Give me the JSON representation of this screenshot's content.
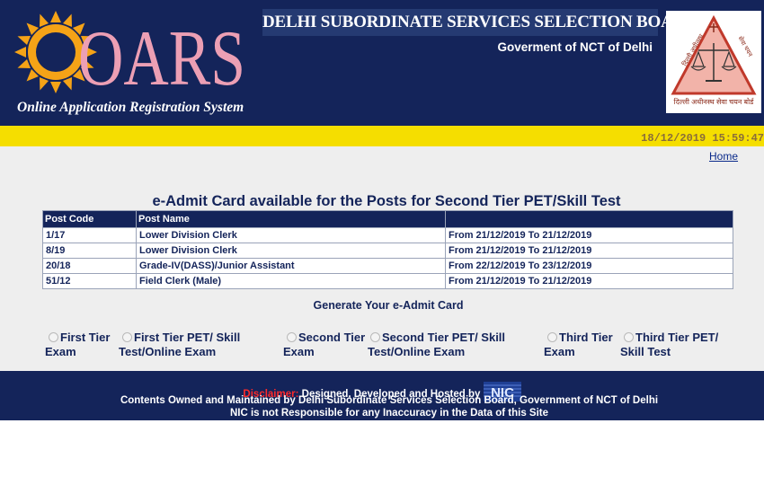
{
  "header": {
    "logo_text": "OARS",
    "tagline": "Online Application Registration System",
    "board_title": "DELHI SUBORDINATE SERVICES SELECTION BOARD",
    "govt": "Goverment of NCT of Delhi",
    "emblem_text": "दिल्ली अधीनस्थ सेवा चयन बोर्ड"
  },
  "datetime": "18/12/2019 15:59:47",
  "nav": {
    "home": "Home"
  },
  "admit": {
    "title": "e-Admit Card available for the Posts for Second Tier PET/Skill Test",
    "columns": [
      "Post Code",
      "Post Name",
      ""
    ],
    "rows": [
      [
        "1/17",
        "Lower Division Clerk",
        "From 21/12/2019 To 21/12/2019"
      ],
      [
        "8/19",
        "Lower Division Clerk",
        "From 21/12/2019 To 21/12/2019"
      ],
      [
        "20/18",
        "Grade-IV(DASS)/Junior Assistant",
        "From 22/12/2019 To 23/12/2019"
      ],
      [
        "51/12",
        "Field Clerk (Male)",
        "From 21/12/2019 To 21/12/2019"
      ]
    ]
  },
  "generate": {
    "label": "Generate Your e-Admit Card",
    "options": [
      {
        "line1": "First Tier",
        "line2": "Exam"
      },
      {
        "line1": "First Tier PET/ Skill",
        "line2": "Test/Online Exam"
      },
      {
        "line1": "Second Tier",
        "line2": "Exam"
      },
      {
        "line1": "Second Tier PET/ Skill",
        "line2": "Test/Online Exam"
      },
      {
        "line1": "Third Tier",
        "line2": "Exam"
      },
      {
        "line1": "Third Tier PET/",
        "line2": "Skill Test"
      }
    ]
  },
  "footer": {
    "disclaimer_label": "Disclaimer:",
    "line1": "Designed, Developed and Hosted by",
    "nic_logo_text": "NIC",
    "line2": "Contents Owned and Maintained by Delhi Subordinate Services Selection Board, Government of NCT of Delhi",
    "line3": "NIC is not Responsible for any Inaccuracy in the Data of this Site"
  },
  "colors": {
    "header_bg": "#14245a",
    "yellow_bar": "#f5de00",
    "logo_pink": "#ec9fb4",
    "sun_orange": "#f5a317",
    "disclaimer_red": "#ff2a2a"
  }
}
